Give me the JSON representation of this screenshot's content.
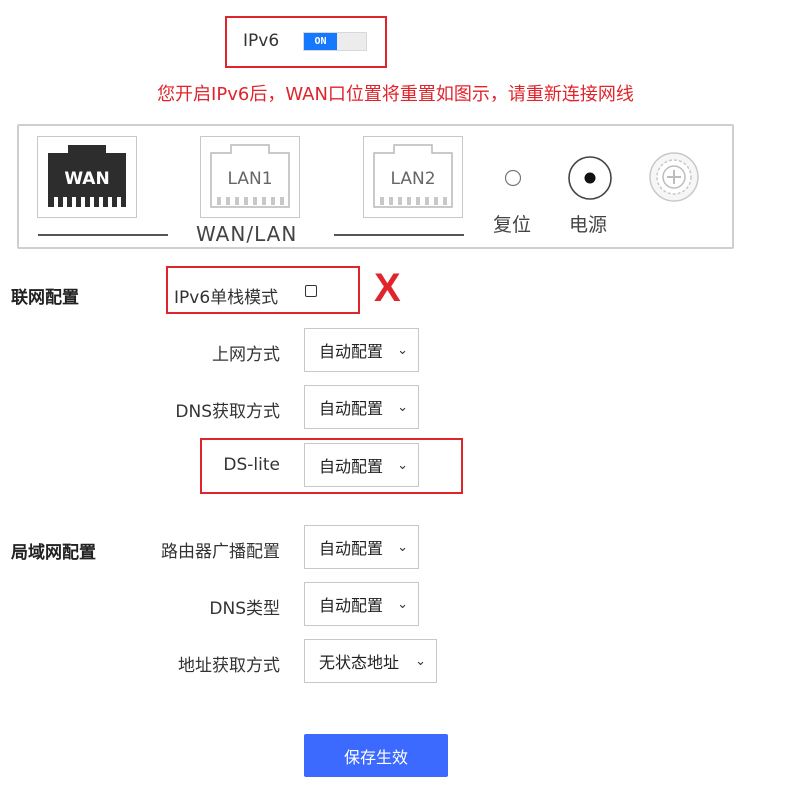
{
  "ipv6": {
    "label": "IPv6",
    "toggle_text": "ON"
  },
  "notice": "您开启IPv6后，WAN口位置将重置如图示，请重新连接网线",
  "panel": {
    "wan": "WAN",
    "lan1": "LAN1",
    "lan2": "LAN2",
    "wan_lan": "WAN/LAN",
    "reset": "复位",
    "power": "电源"
  },
  "network": {
    "title": "联网配置",
    "single_stack_label": "IPv6单栈模式",
    "single_stack_checked": false,
    "x_mark": "X",
    "connection_label": "上网方式",
    "connection_value": "自动配置",
    "dns_label": "DNS获取方式",
    "dns_value": "自动配置",
    "dslite_label": "DS-lite",
    "dslite_value": "自动配置"
  },
  "lan": {
    "title": "局域网配置",
    "router_adv_label": "路由器广播配置",
    "router_adv_value": "自动配置",
    "dns_type_label": "DNS类型",
    "dns_type_value": "自动配置",
    "addr_label": "地址获取方式",
    "addr_value": "无状态地址"
  },
  "save_label": "保存生效",
  "colors": {
    "accent": "#3c6aff",
    "toggle": "#1677ff",
    "highlight": "#e0242b"
  }
}
